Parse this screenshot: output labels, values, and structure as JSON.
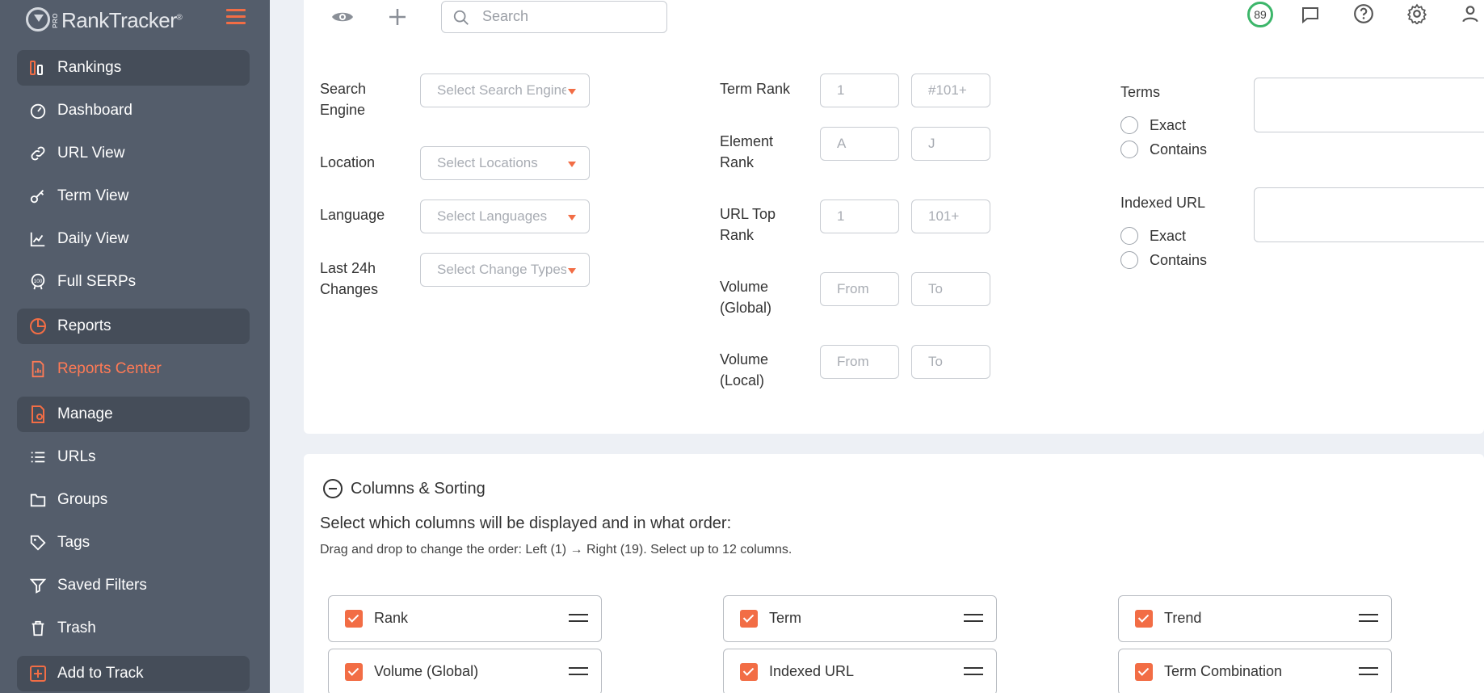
{
  "app": {
    "logo_badge": "PRO",
    "logo_text": "RankTracker",
    "logo_mark": "®"
  },
  "sidebar": {
    "items": [
      {
        "label": "Rankings",
        "icon": "rankings-icon",
        "section": true
      },
      {
        "label": "Dashboard",
        "icon": "dashboard-icon"
      },
      {
        "label": "URL View",
        "icon": "link-icon"
      },
      {
        "label": "Term View",
        "icon": "key-icon"
      },
      {
        "label": "Daily View",
        "icon": "line-chart-icon"
      },
      {
        "label": "Full SERPs",
        "icon": "serp-100-icon"
      },
      {
        "label": "Reports",
        "icon": "pie-chart-icon",
        "section": true
      },
      {
        "label": "Reports Center",
        "icon": "report-doc-icon",
        "highlight": true
      },
      {
        "label": "Manage",
        "icon": "manage-doc-icon",
        "section": true
      },
      {
        "label": "URLs",
        "icon": "list-icon"
      },
      {
        "label": "Groups",
        "icon": "folder-icon"
      },
      {
        "label": "Tags",
        "icon": "tag-icon"
      },
      {
        "label": "Saved Filters",
        "icon": "filter-icon"
      },
      {
        "label": "Trash",
        "icon": "trash-icon"
      },
      {
        "label": "Add to Track",
        "icon": "plus-square-icon",
        "section": true
      }
    ]
  },
  "topbar": {
    "search_placeholder": "Search",
    "score": "89"
  },
  "filters": {
    "search_engine": {
      "label": "Search Engine",
      "placeholder": "Select Search Engine"
    },
    "location": {
      "label": "Location",
      "placeholder": "Select Locations"
    },
    "language": {
      "label": "Language",
      "placeholder": "Select Languages"
    },
    "changes": {
      "label": "Last 24h Changes",
      "placeholder": "Select Change Types"
    },
    "term_rank": {
      "label": "Term Rank",
      "from": "1",
      "to": "#101+"
    },
    "element_rank": {
      "label": "Element Rank",
      "from": "A",
      "to": "J"
    },
    "url_top_rank": {
      "label": "URL Top Rank",
      "from": "1",
      "to": "101+"
    },
    "volume_global": {
      "label": "Volume (Global)",
      "from": "From",
      "to": "To"
    },
    "volume_local": {
      "label": "Volume (Local)",
      "from": "From",
      "to": "To"
    },
    "terms": {
      "label": "Terms",
      "exact": "Exact",
      "contains": "Contains"
    },
    "indexed_url": {
      "label": "Indexed URL",
      "exact": "Exact",
      "contains": "Contains"
    }
  },
  "columns": {
    "title": "Columns & Sorting",
    "subtitle": "Select which columns will be displayed and in what order:",
    "hint": "Drag and drop to change the order: Left (1) → Right (19). Select up to 12 columns.",
    "items": [
      {
        "label": "Rank",
        "checked": true
      },
      {
        "label": "Term",
        "checked": true
      },
      {
        "label": "Trend",
        "checked": true
      },
      {
        "label": "Volume (Global)",
        "checked": true
      },
      {
        "label": "Indexed URL",
        "checked": true
      },
      {
        "label": "Term Combination",
        "checked": true
      }
    ]
  },
  "colors": {
    "accent": "#f26d45",
    "sidebar_bg": "#545d6b",
    "sidebar_active": "#454d59",
    "score_ring": "#3cb66a"
  }
}
